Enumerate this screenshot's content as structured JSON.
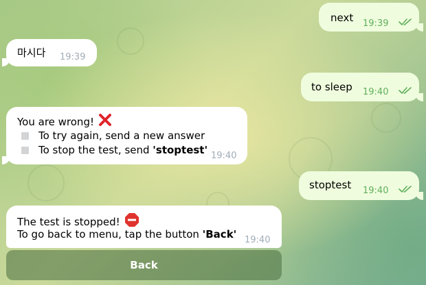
{
  "messages": {
    "m1": {
      "text": "next",
      "time": "19:39"
    },
    "m2": {
      "text": "마시다",
      "time": "19:39"
    },
    "m3": {
      "text": "to sleep",
      "time": "19:40"
    },
    "m4": {
      "line1": "You are wrong!",
      "item1": "To try again, send a new answer",
      "item2_prefix": "To stop the test, send ",
      "item2_bold": "'stoptest'",
      "time": "19:40"
    },
    "m5": {
      "text": "stoptest",
      "time": "19:40"
    },
    "m6": {
      "line1": "The test is stopped!",
      "line2_prefix": "To go back to menu, tap the button ",
      "line2_bold": "'Back'",
      "time": "19:40"
    }
  },
  "keyboard": {
    "back_label": "Back"
  },
  "icons": {
    "read_receipt": "double-check-icon",
    "wrong": "red-cross-icon",
    "stop": "stop-sign-icon",
    "bullet": "grey-square-icon"
  },
  "colors": {
    "outgoing_bubble": "#effdde",
    "incoming_bubble": "#ffffff",
    "outgoing_time": "#5fae5a",
    "incoming_time": "#a0acb6",
    "wrong_cross": "#e0242a",
    "stop_sign": "#e0332e"
  }
}
